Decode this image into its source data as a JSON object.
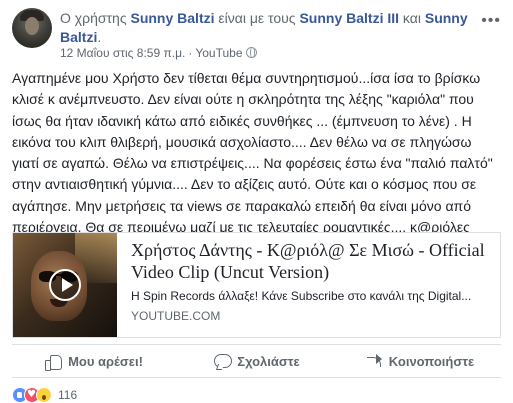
{
  "header": {
    "prefix": "Ο χρήστης",
    "author": "Sunny Baltzi",
    "middle": "είναι με τους",
    "tagged_1": "Sunny Baltzi III",
    "conj": "και",
    "tagged_2": "Sunny Baltzi",
    "end": ".",
    "timestamp": "12 Μαΐου στις 8:59 π.μ.",
    "separator": "·",
    "source": "YouTube",
    "menu_label": "•••"
  },
  "post": {
    "text": "Αγαπημένε μου Χρήστο δεν τίθεται θέμα συντηρητισμού...ίσα ίσα το βρίσκω κλισέ κ ανέμπνευστο. Δεν είναι ούτε η σκληρότητα της λέξης \"καριόλα\" που ίσως θα ήταν ιδανική κάτω από ειδικές συνθήκες ... (έμπνευση το λένε) . Η εικόνα του κλιπ θλιβερή, μουσικά ασχολίαστο.... Δεν θέλω να σε πληγώσω γιατί σε αγαπώ. Θέλω να επιστρέψεις.... Να φορέσεις έστω ένα \"παλιό παλτό\" στην αντιαισθητική γύμνια.... Δεν το αξίζεις αυτό. Ούτε και ο κόσμος που σε αγάπησε. Μην μετρήσεις τα views σε παρακαλώ επειδή θα είναι μόνο από περιέργεια. Θα σε περιμένω μαζί με τις τελευταίες ρομαντικές.... κ@ριόλες"
  },
  "link_card": {
    "title": "Χρήστος Δάντης - Κ@ριόλ@ Σε Μισώ - Official Video Clip (Uncut Version)",
    "description": "Η Spin Records άλλαξε! Κάνε Subscribe στο κανάλι της Digital...",
    "domain": "YOUTUBE.COM"
  },
  "actions": {
    "like": "Μου αρέσει!",
    "comment": "Σχολιάστε",
    "share": "Κοινοποιήστε"
  },
  "reactions": {
    "count": "116",
    "types": [
      "like",
      "love",
      "wow"
    ]
  },
  "colors": {
    "link_blue": "#385898",
    "meta_grey": "#606770",
    "text": "#1d2129",
    "border": "#dddfe2",
    "like_blue": "#5890ff",
    "love_red": "#f25268",
    "wow_yellow": "#fcd240"
  }
}
